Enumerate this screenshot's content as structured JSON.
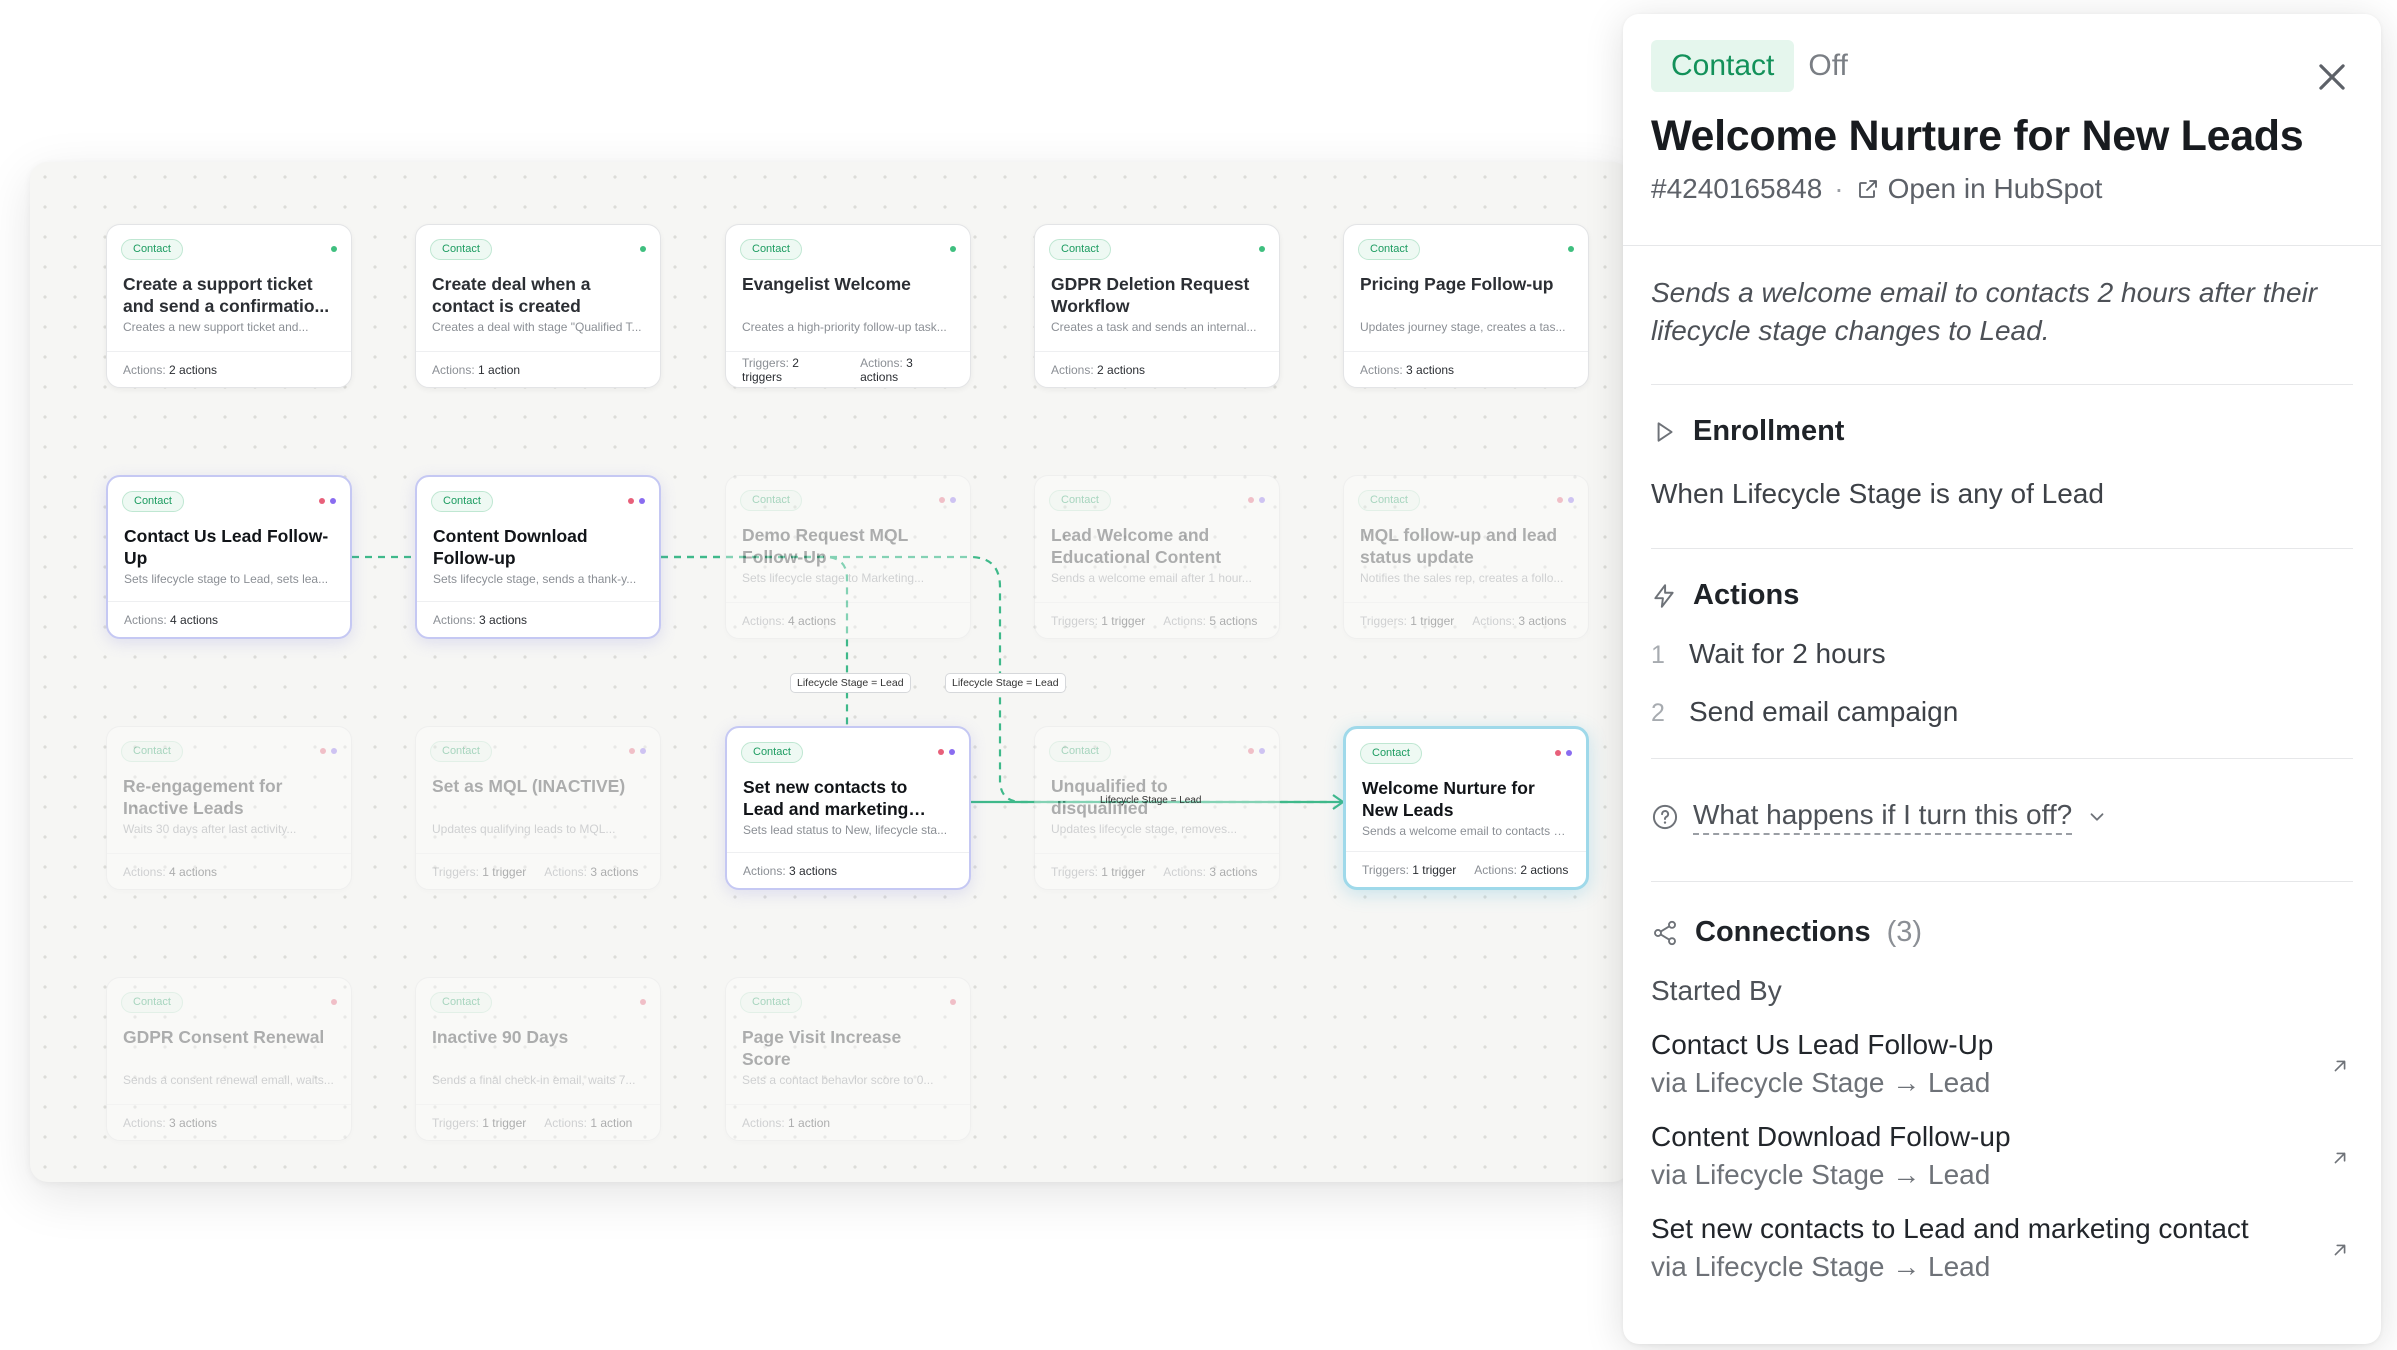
{
  "canvas": {
    "cards": [
      {
        "id": "c1",
        "col": 0,
        "row": 0,
        "state": "normal",
        "tag": "Contact",
        "dots": [
          "#3fbf7f"
        ],
        "title": "Create a support ticket and send a confirmatio...",
        "desc": "Creates a new support ticket and...",
        "triggers": "",
        "actions": "2 actions"
      },
      {
        "id": "c2",
        "col": 1,
        "row": 0,
        "state": "normal",
        "tag": "Contact",
        "dots": [
          "#3fbf7f"
        ],
        "title": "Create deal when a contact is created",
        "desc": "Creates a deal with stage \"Qualified T...",
        "triggers": "",
        "actions": "1 action"
      },
      {
        "id": "c3",
        "col": 2,
        "row": 0,
        "state": "normal",
        "tag": "Contact",
        "dots": [
          "#3fbf7f"
        ],
        "title": "Evangelist Welcome",
        "desc": "Creates a high-priority follow-up task...",
        "triggers": "2 triggers",
        "actions": "3 actions"
      },
      {
        "id": "c4",
        "col": 3,
        "row": 0,
        "state": "normal",
        "tag": "Contact",
        "dots": [
          "#3fbf7f"
        ],
        "title": "GDPR Deletion Request Workflow",
        "desc": "Creates a task and sends an internal...",
        "triggers": "",
        "actions": "2 actions"
      },
      {
        "id": "c5",
        "col": 4,
        "row": 0,
        "state": "normal",
        "tag": "Contact",
        "dots": [
          "#3fbf7f"
        ],
        "title": "Pricing Page Follow-up",
        "desc": "Updates journey stage, creates a tas...",
        "triggers": "",
        "actions": "3 actions"
      },
      {
        "id": "c6",
        "col": 0,
        "row": 1,
        "state": "active",
        "tag": "Contact",
        "dots": [
          "#e8607a",
          "#8a6cf0"
        ],
        "title": "Contact Us Lead Follow-Up",
        "desc": "Sets lifecycle stage to Lead, sets lea...",
        "triggers": "",
        "actions": "4 actions"
      },
      {
        "id": "c7",
        "col": 1,
        "row": 1,
        "state": "active",
        "tag": "Contact",
        "dots": [
          "#e8607a",
          "#8a6cf0"
        ],
        "title": "Content Download Follow-up",
        "desc": "Sets lifecycle stage, sends a thank-y...",
        "triggers": "",
        "actions": "3 actions"
      },
      {
        "id": "c8",
        "col": 2,
        "row": 1,
        "state": "dim",
        "tag": "Contact",
        "dots": [
          "#e8607a",
          "#8a6cf0"
        ],
        "title": "Demo Request MQL Follow-Up",
        "desc": "Sets lifecycle stage to Marketing...",
        "triggers": "",
        "actions": "4 actions"
      },
      {
        "id": "c9",
        "col": 3,
        "row": 1,
        "state": "dim",
        "tag": "Contact",
        "dots": [
          "#e8607a",
          "#8a6cf0"
        ],
        "title": "Lead Welcome and Educational Content",
        "desc": "Sends a welcome email after 1 hour...",
        "triggers": "1 trigger",
        "actions": "5 actions"
      },
      {
        "id": "c10",
        "col": 4,
        "row": 1,
        "state": "dim",
        "tag": "Contact",
        "dots": [
          "#e8607a",
          "#8a6cf0"
        ],
        "title": "MQL follow-up and lead status update",
        "desc": "Notifies the sales rep, creates a follo...",
        "triggers": "1 trigger",
        "actions": "3 actions"
      },
      {
        "id": "c11",
        "col": 0,
        "row": 2,
        "state": "dim",
        "tag": "Contact",
        "dots": [
          "#e8607a",
          "#8a6cf0"
        ],
        "title": "Re-engagement for Inactive Leads",
        "desc": "Waits 30 days after last activity...",
        "triggers": "",
        "actions": "4 actions"
      },
      {
        "id": "c12",
        "col": 1,
        "row": 2,
        "state": "dim",
        "tag": "Contact",
        "dots": [
          "#e8607a",
          "#8a6cf0"
        ],
        "title": "Set as MQL (INACTIVE)",
        "desc": "Updates qualifying leads to MQL...",
        "triggers": "1 trigger",
        "actions": "3 actions"
      },
      {
        "id": "c13",
        "col": 2,
        "row": 2,
        "state": "active",
        "tag": "Contact",
        "dots": [
          "#e8607a",
          "#8a6cf0"
        ],
        "title": "Set new contacts to Lead and marketing contact",
        "desc": "Sets lead status to New, lifecycle sta...",
        "triggers": "",
        "actions": "3 actions"
      },
      {
        "id": "c14",
        "col": 3,
        "row": 2,
        "state": "dim",
        "tag": "Contact",
        "dots": [
          "#e8607a",
          "#8a6cf0"
        ],
        "title": "Unqualified to disqualified",
        "desc": "Updates lifecycle stage, removes...",
        "triggers": "1 trigger",
        "actions": "3 actions"
      },
      {
        "id": "c15",
        "col": 4,
        "row": 2,
        "state": "selected",
        "tag": "Contact",
        "dots": [
          "#e8607a",
          "#8a6cf0"
        ],
        "title": "Welcome Nurture for New Leads",
        "desc": "Sends a welcome email to contacts 2...",
        "triggers": "1 trigger",
        "actions": "2 actions"
      },
      {
        "id": "c16",
        "col": 0,
        "row": 3,
        "state": "dim",
        "tag": "Contact",
        "dots": [
          "#e8607a"
        ],
        "title": "GDPR Consent Renewal",
        "desc": "Sends a consent renewal email, waits...",
        "triggers": "",
        "actions": "3 actions"
      },
      {
        "id": "c17",
        "col": 1,
        "row": 3,
        "state": "dim",
        "tag": "Contact",
        "dots": [
          "#e8607a"
        ],
        "title": "Inactive 90 Days",
        "desc": "Sends a final check-in email, waits 7...",
        "triggers": "1 trigger",
        "actions": "1 action"
      },
      {
        "id": "c18",
        "col": 2,
        "row": 3,
        "state": "dim",
        "tag": "Contact",
        "dots": [
          "#e8607a"
        ],
        "title": "Page Visit Increase Score",
        "desc": "Sets a contact behavior score to 0...",
        "triggers": "",
        "actions": "1 action"
      }
    ],
    "labels": {
      "triggers": "Triggers:",
      "actions": "Actions:"
    },
    "edge_labels": {
      "left": "Lifecycle Stage = Lead",
      "right": "Lifecycle Stage = Lead",
      "bottom": "Lifecycle Stage = Lead"
    },
    "colors": {
      "edge": "#3fb98a"
    }
  },
  "panel": {
    "type_badge": "Contact",
    "status": "Off",
    "title": "Welcome Nurture for New Leads",
    "workflow_id": "#4240165848",
    "separator": "·",
    "open_link": "Open in HubSpot",
    "description": "Sends a welcome email to contacts 2 hours after their lifecycle stage changes to Lead.",
    "enrollment": {
      "heading": "Enrollment",
      "text": "When Lifecycle Stage is any of Lead"
    },
    "actions": {
      "heading": "Actions",
      "items": [
        {
          "n": "1",
          "label": "Wait for 2 hours"
        },
        {
          "n": "2",
          "label": "Send email campaign"
        }
      ]
    },
    "faq": "What happens if I turn this off?",
    "connections": {
      "heading": "Connections",
      "count": "(3)",
      "subheading": "Started By",
      "items": [
        {
          "name": "Contact Us Lead Follow-Up",
          "via": "via Lifecycle Stage → Lead"
        },
        {
          "name": "Content Download Follow-up",
          "via": "via Lifecycle Stage → Lead"
        },
        {
          "name": "Set new contacts to Lead and marketing contact",
          "via": "via Lifecycle Stage → Lead"
        }
      ]
    },
    "colors": {
      "badge_bg": "#e5f6ed",
      "badge_text": "#13915a"
    }
  }
}
